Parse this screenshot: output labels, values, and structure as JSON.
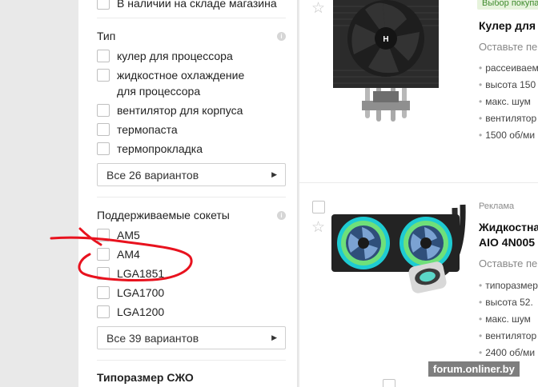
{
  "filters": {
    "stock_partial": "В наличии на складе магазина",
    "type_section": {
      "title": "Тип",
      "items": [
        "кулер для процессора",
        "жидкостное охлаждение",
        "для процессора",
        "вентилятор для корпуса",
        "термопаста",
        "термопрокладка"
      ],
      "variants_label": "Все 26 вариантов"
    },
    "socket_section": {
      "title": "Поддерживаемые сокеты",
      "items": [
        "AM5",
        "AM4",
        "LGA1851",
        "LGA1700",
        "LGA1200"
      ],
      "variants_label": "Все 39 вариантов"
    },
    "size_section": {
      "title": "Типоразмер СЖО"
    },
    "info_icon_glyph": "i",
    "chevron_glyph": "▶"
  },
  "products": [
    {
      "promo": "Выбор покупа",
      "title": "Кулер для",
      "review": "Оставьте пе",
      "specs": [
        "рассеиваем",
        "высота 150",
        "макс. шум",
        "вентилятор",
        "1500 об/ми"
      ]
    },
    {
      "ad": "Реклама",
      "title_line1": "Жидкостна",
      "title_line2": "AIO 4N005",
      "review": "Оставьте пе",
      "specs": [
        "типоразмер",
        "высота 52.",
        "макс. шум",
        "вентилятор",
        "2400 об/ми"
      ]
    }
  ],
  "watermark": "forum.onliner.by",
  "annotation_color": "#e8121e",
  "star_glyph": "☆"
}
